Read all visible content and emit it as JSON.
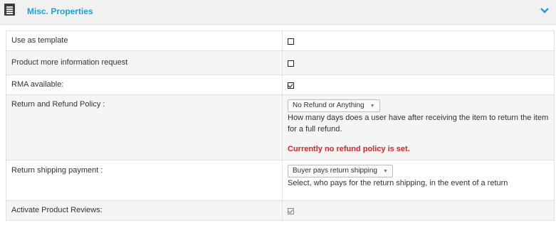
{
  "header": {
    "title": "Misc. Properties"
  },
  "rows": [
    {
      "label": "Use as template",
      "checkbox": false
    },
    {
      "label": "Product more information request",
      "checkbox": false
    },
    {
      "label": "RMA available:",
      "checkbox": true
    },
    {
      "label": "Return and Refund Policy :",
      "select_value": "No Refund or Anything",
      "help": "How many days does a user have after receiving the item to return the item for a full refund.",
      "warning": "Currently no refund policy is set."
    },
    {
      "label": "Return shipping payment :",
      "select_value": "Buyer pays return shipping",
      "help": "Select, who pays for the return shipping, in the event of a return"
    },
    {
      "label": "Activate Product Reviews:",
      "checkbox": true
    }
  ],
  "colors": {
    "accent": "#1d9fd6",
    "warning": "#e02020"
  }
}
